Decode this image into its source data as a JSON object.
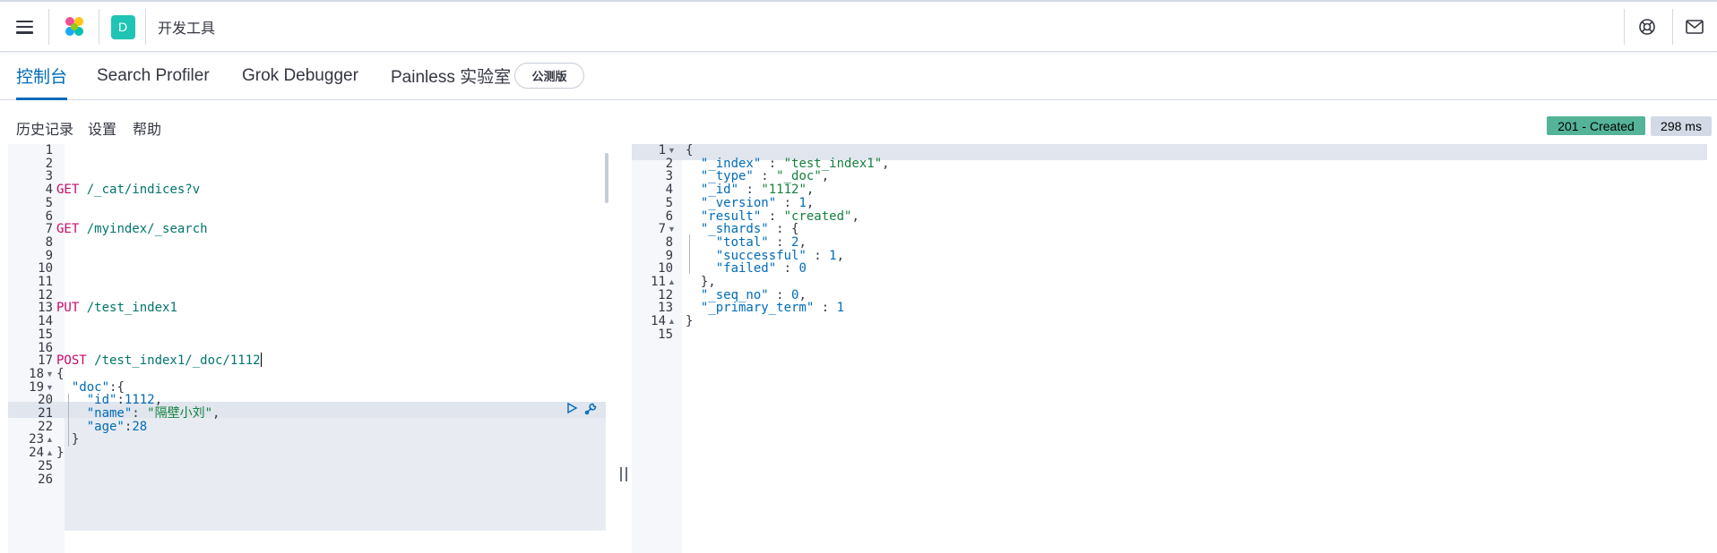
{
  "header": {
    "breadcrumb": "开发工具",
    "space_initial": "D",
    "icons": [
      "menu-icon",
      "elastic-logo-icon",
      "help-icon",
      "mail-icon"
    ]
  },
  "tabs": [
    {
      "label": "控制台",
      "active": true
    },
    {
      "label": "Search Profiler",
      "active": false
    },
    {
      "label": "Grok Debugger",
      "active": false
    },
    {
      "label": "Painless 实验室",
      "active": false
    }
  ],
  "beta_badge": "公测版",
  "toolbar": {
    "history": "历史记录",
    "settings": "设置",
    "help": "帮助"
  },
  "response_status": {
    "status": "201 - Created",
    "time": "298 ms"
  },
  "request_editor": {
    "lines": [
      {
        "n": "1",
        "method": "",
        "path": "",
        "text": ""
      },
      {
        "n": "2",
        "method": "",
        "path": "",
        "text": ""
      },
      {
        "n": "3",
        "method": "",
        "path": "",
        "text": ""
      },
      {
        "n": "4",
        "method": "GET",
        "path": " /_cat/indices?v",
        "text": ""
      },
      {
        "n": "5",
        "method": "",
        "path": "",
        "text": ""
      },
      {
        "n": "6",
        "method": "",
        "path": "",
        "text": ""
      },
      {
        "n": "7",
        "method": "GET",
        "path": " /myindex/_search",
        "text": ""
      },
      {
        "n": "8",
        "method": "",
        "path": "",
        "text": ""
      },
      {
        "n": "9",
        "method": "",
        "path": "",
        "text": ""
      },
      {
        "n": "10",
        "method": "",
        "path": "",
        "text": ""
      },
      {
        "n": "11",
        "method": "",
        "path": "",
        "text": ""
      },
      {
        "n": "12",
        "method": "",
        "path": "",
        "text": ""
      },
      {
        "n": "13",
        "method": "PUT",
        "path": " /test_index1",
        "text": ""
      },
      {
        "n": "14",
        "method": "",
        "path": "",
        "text": ""
      },
      {
        "n": "15",
        "method": "",
        "path": "",
        "text": ""
      },
      {
        "n": "16",
        "method": "",
        "path": "",
        "text": ""
      },
      {
        "n": "17",
        "method": "POST",
        "path": " /test_index1/_doc/1112",
        "text": ""
      },
      {
        "n": "18",
        "method": "",
        "path": "",
        "text": "{"
      },
      {
        "n": "19",
        "method": "",
        "path": "",
        "text": "  \"doc\":{"
      },
      {
        "n": "20",
        "method": "",
        "path": "",
        "text": "    \"id\":1112,"
      },
      {
        "n": "21",
        "method": "",
        "path": "",
        "text": "    \"name\": \"隔壁小刘\","
      },
      {
        "n": "22",
        "method": "",
        "path": "",
        "text": "    \"age\":28"
      },
      {
        "n": "23",
        "method": "",
        "path": "",
        "text": "  }"
      },
      {
        "n": "24",
        "method": "",
        "path": "",
        "text": "}"
      },
      {
        "n": "25",
        "method": "",
        "path": "",
        "text": ""
      },
      {
        "n": "26",
        "method": "",
        "path": "",
        "text": ""
      }
    ]
  },
  "response_editor": {
    "lines": [
      {
        "n": "1",
        "text": "{"
      },
      {
        "n": "2",
        "text": "  \"_index\" : \"test_index1\","
      },
      {
        "n": "3",
        "text": "  \"_type\" : \"_doc\","
      },
      {
        "n": "4",
        "text": "  \"_id\" : \"1112\","
      },
      {
        "n": "5",
        "text": "  \"_version\" : 1,"
      },
      {
        "n": "6",
        "text": "  \"result\" : \"created\","
      },
      {
        "n": "7",
        "text": "  \"_shards\" : {"
      },
      {
        "n": "8",
        "text": "    \"total\" : 2,"
      },
      {
        "n": "9",
        "text": "    \"successful\" : 1,"
      },
      {
        "n": "10",
        "text": "    \"failed\" : 0"
      },
      {
        "n": "11",
        "text": "  },"
      },
      {
        "n": "12",
        "text": "  \"_seq_no\" : 0,"
      },
      {
        "n": "13",
        "text": "  \"_primary_term\" : 1"
      },
      {
        "n": "14",
        "text": "}"
      },
      {
        "n": "15",
        "text": ""
      }
    ]
  },
  "colors": {
    "accent": "#006bb8",
    "method": "#c80a68",
    "path": "#00756c",
    "string": "#15803d",
    "status_ok": "#54b399"
  }
}
